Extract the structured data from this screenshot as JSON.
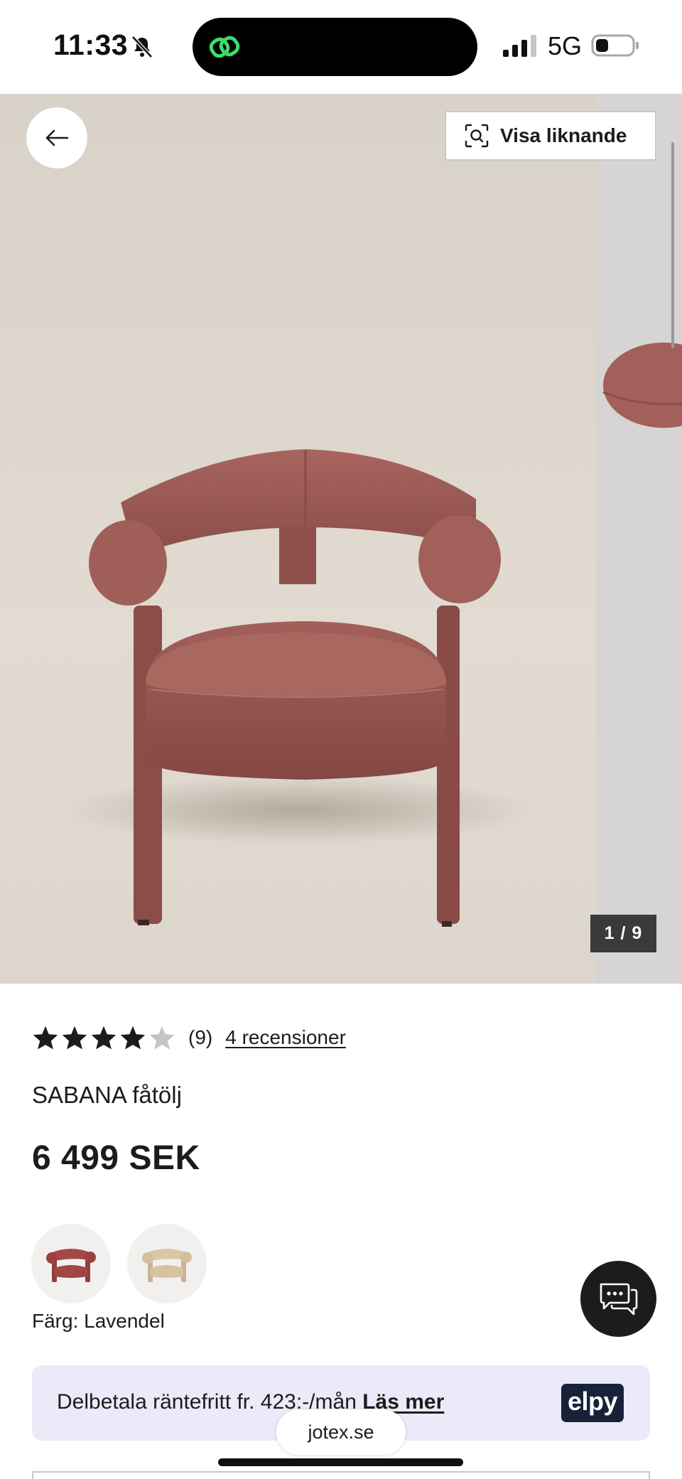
{
  "status_bar": {
    "time": "11:33",
    "network": "5G",
    "icons": [
      "bell-slash-icon",
      "app-chain-icon",
      "signal-icon",
      "battery-icon"
    ]
  },
  "gallery": {
    "similar_button_label": "Visa liknande",
    "counter": "1 / 9",
    "current_image": 1,
    "total_images": 9,
    "icons": [
      "arrow-left-icon",
      "visual-search-icon"
    ]
  },
  "product": {
    "rating": 4,
    "rating_max": 5,
    "rating_count": "(9)",
    "reviews_link": "4 recensioner",
    "title": "SABANA fåtölj",
    "price": "6 499 SEK",
    "swatches": [
      {
        "name": "rose-velvet",
        "color": "#a8595a"
      },
      {
        "name": "beige",
        "color": "#d8c6a5"
      }
    ],
    "color_label": "Färg: Lavendel"
  },
  "installment": {
    "text": "Delbetala räntefritt fr. 423:-/mån ",
    "link": "Läs mer",
    "brand": "elpy",
    "brand_color": "#17223a"
  },
  "browser": {
    "url": "jotex.se"
  },
  "colors": {
    "chair": "#9b5a55",
    "banner_bg": "#eaeaf8",
    "chat_bg": "#1c1c1c",
    "island_icon": "#3ddc6a"
  }
}
